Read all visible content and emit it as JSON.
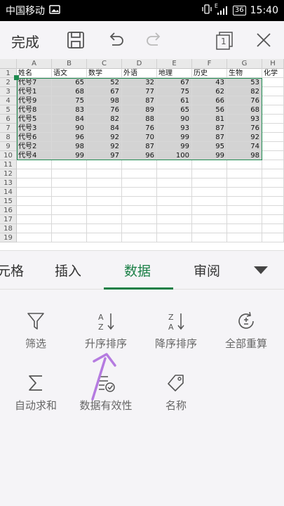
{
  "status": {
    "carrier": "中国移动",
    "network": "E",
    "battery": "36",
    "time": "15:40"
  },
  "toolbar": {
    "done_label": "完成",
    "page_count": "1"
  },
  "sheet": {
    "columns": [
      "A",
      "B",
      "C",
      "D",
      "E",
      "F",
      "G",
      "H"
    ],
    "row_numbers": [
      "1",
      "2",
      "3",
      "4",
      "5",
      "6",
      "7",
      "8",
      "9",
      "10",
      "11",
      "12",
      "13",
      "14",
      "15",
      "16",
      "17",
      "18",
      "19"
    ],
    "header": [
      "姓名",
      "语文",
      "数学",
      "外语",
      "地理",
      "历史",
      "生物",
      "化学"
    ],
    "rows": [
      [
        "代号7",
        "65",
        "52",
        "32",
        "67",
        "43",
        "53"
      ],
      [
        "代号1",
        "68",
        "67",
        "77",
        "75",
        "62",
        "82"
      ],
      [
        "代号9",
        "75",
        "98",
        "87",
        "61",
        "66",
        "76"
      ],
      [
        "代号8",
        "83",
        "76",
        "89",
        "65",
        "56",
        "68"
      ],
      [
        "代号5",
        "84",
        "82",
        "88",
        "90",
        "81",
        "93"
      ],
      [
        "代号3",
        "90",
        "84",
        "76",
        "93",
        "87",
        "76"
      ],
      [
        "代号6",
        "96",
        "92",
        "70",
        "99",
        "87",
        "92"
      ],
      [
        "代号2",
        "98",
        "92",
        "87",
        "99",
        "95",
        "74"
      ],
      [
        "代号4",
        "99",
        "97",
        "96",
        "100",
        "99",
        "98"
      ]
    ]
  },
  "tabs": [
    {
      "label": "元格",
      "active": false
    },
    {
      "label": "插入",
      "active": false
    },
    {
      "label": "数据",
      "active": true
    },
    {
      "label": "审阅",
      "active": false
    }
  ],
  "tools": {
    "filter": "筛选",
    "sort_asc": "升序排序",
    "sort_desc": "降序排序",
    "recalc": "全部重算",
    "autosum": "自动求和",
    "validation": "数据有效性",
    "name": "名称"
  },
  "colors": {
    "accent": "#1a7f46",
    "selection": "#d3d3d3",
    "annotation": "#b57be0"
  }
}
